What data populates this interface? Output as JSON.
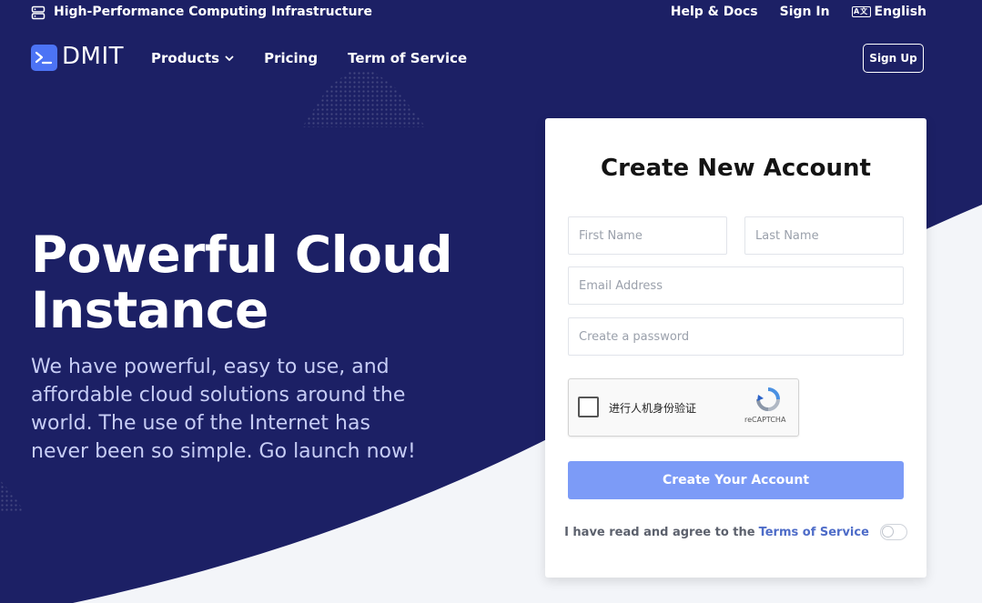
{
  "topbar": {
    "title": "High-Performance Computing Infrastructure",
    "icon": "server-icon",
    "links": {
      "help": "Help & Docs",
      "signin": "Sign In",
      "language": "English",
      "language_icon": "translate-icon",
      "language_icon_text": "A文"
    }
  },
  "header": {
    "logo_text": "DMIT",
    "logo_icon": "terminal-icon",
    "nav": {
      "products": "Products",
      "pricing": "Pricing",
      "terms": "Term of Service"
    },
    "signup_label": "Sign Up"
  },
  "hero": {
    "title": "Powerful Cloud Instance",
    "subtitle": "We have powerful, easy to use, and affordable cloud solutions around the world. The use of the Internet has never been so simple. Go launch now!"
  },
  "signup_card": {
    "title": "Create New Account",
    "fields": {
      "first_name_placeholder": "First Name",
      "last_name_placeholder": "Last Name",
      "email_placeholder": "Email Address",
      "password_placeholder": "Create a password"
    },
    "captcha": {
      "label": "进行人机身份验证",
      "brand": "reCAPTCHA",
      "checked": false
    },
    "submit_label": "Create Your Account",
    "agree_text": "I have read and agree to the",
    "agree_link": "Terms of Service",
    "agree_toggle_on": false
  },
  "colors": {
    "background": "#1c2065",
    "accent": "#4c73f5",
    "submit_button": "#7c9bf7",
    "link": "#4e6cc8",
    "light_section": "#f3f5f9"
  }
}
